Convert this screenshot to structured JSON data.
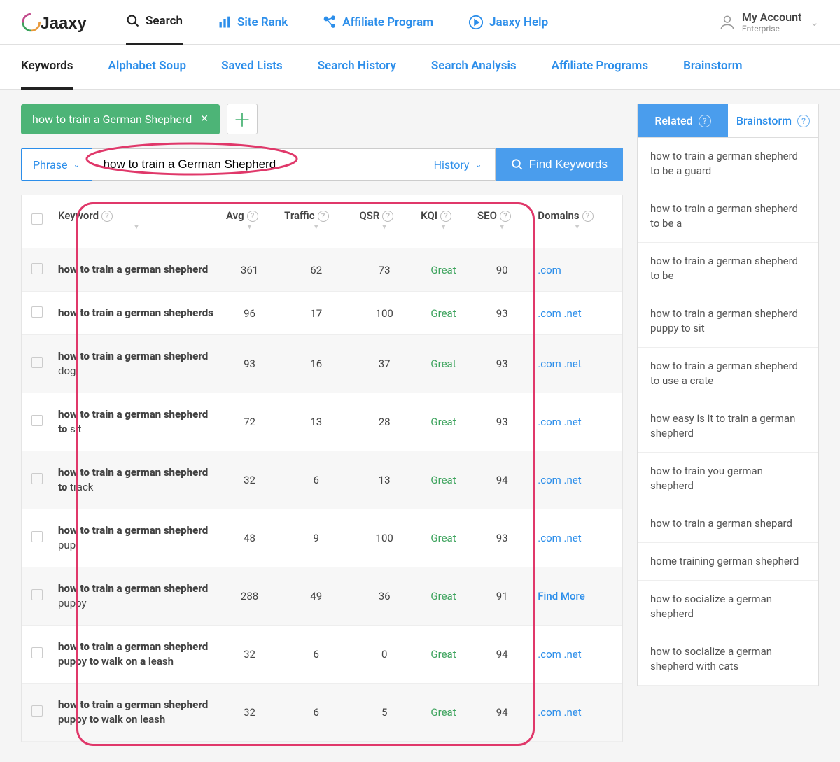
{
  "brand": "Jaaxy",
  "topnav": {
    "items": [
      {
        "label": "Search",
        "active": true
      },
      {
        "label": "Site Rank"
      },
      {
        "label": "Affiliate Program"
      },
      {
        "label": "Jaaxy Help"
      }
    ]
  },
  "account": {
    "name": "My Account",
    "plan": "Enterprise"
  },
  "tabs": [
    {
      "label": "Keywords",
      "active": true
    },
    {
      "label": "Alphabet Soup"
    },
    {
      "label": "Saved Lists"
    },
    {
      "label": "Search History"
    },
    {
      "label": "Search Analysis"
    },
    {
      "label": "Affiliate Programs"
    },
    {
      "label": "Brainstorm"
    }
  ],
  "chip": {
    "label": "how to train a German Shepherd"
  },
  "search": {
    "phrase_label": "Phrase",
    "input_value": "how to train a German Shepherd",
    "history_label": "History",
    "find_label": "Find Keywords"
  },
  "columns": {
    "keyword": "Keyword",
    "avg": "Avg",
    "traffic": "Traffic",
    "qsr": "QSR",
    "kqi": "KQI",
    "seo": "SEO",
    "domains": "Domains"
  },
  "rows": [
    {
      "kw_bold": "how to train a german shepherd",
      "kw_rest": "",
      "avg": "361",
      "traffic": "62",
      "qsr": "73",
      "kqi": "Great",
      "seo": "90",
      "domains": ".com"
    },
    {
      "kw_bold": "how to train a german shepherds",
      "kw_rest": "",
      "avg": "96",
      "traffic": "17",
      "qsr": "100",
      "kqi": "Great",
      "seo": "93",
      "domains": ".com .net"
    },
    {
      "kw_bold": "how to train a german shepherd",
      "kw_rest": " dog",
      "avg": "93",
      "traffic": "16",
      "qsr": "37",
      "kqi": "Great",
      "seo": "93",
      "domains": ".com .net"
    },
    {
      "kw_bold": "how to train a german shepherd to",
      "kw_rest": " sit",
      "avg": "72",
      "traffic": "13",
      "qsr": "28",
      "kqi": "Great",
      "seo": "93",
      "domains": ".com .net"
    },
    {
      "kw_bold": "how to train a german shepherd to",
      "kw_rest": " track",
      "avg": "32",
      "traffic": "6",
      "qsr": "13",
      "kqi": "Great",
      "seo": "94",
      "domains": ".com .net"
    },
    {
      "kw_bold": "how to train a german shepherd",
      "kw_rest": " pup",
      "avg": "48",
      "traffic": "9",
      "qsr": "100",
      "kqi": "Great",
      "seo": "93",
      "domains": ".com .net"
    },
    {
      "kw_bold": "how to train a german shepherd",
      "kw_rest": " puppy",
      "avg": "288",
      "traffic": "49",
      "qsr": "36",
      "kqi": "Great",
      "seo": "91",
      "domains": "Find More",
      "find_more": true
    },
    {
      "kw_html": "<b>how to train a german shepherd</b> puppy <b>to</b> walk on <b>a</b> leash",
      "avg": "32",
      "traffic": "6",
      "qsr": "0",
      "kqi": "Great",
      "seo": "94",
      "domains": ".com .net"
    },
    {
      "kw_html": "<b>how to train a german shepherd</b> puppy <b>to</b> walk on leash",
      "avg": "32",
      "traffic": "6",
      "qsr": "5",
      "kqi": "Great",
      "seo": "94",
      "domains": ".com .net"
    }
  ],
  "sidebar": {
    "tab_related": "Related",
    "tab_brainstorm": "Brainstorm",
    "items": [
      "how to train a german shepherd to be a guard",
      "how to train a german shepherd to be a",
      "how to train a german shepherd to be",
      "how to train a german shepherd puppy to sit",
      "how to train a german shepherd to use a crate",
      "how easy is it to train a german shepherd",
      "how to train you german shepherd",
      "how to train a german shepard",
      "home training german shepherd",
      "how to socialize a german shepherd",
      "how to socialize a german shepherd with cats"
    ]
  }
}
